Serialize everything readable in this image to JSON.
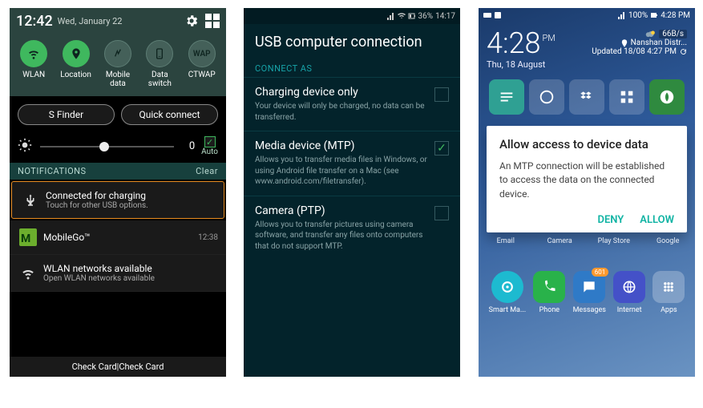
{
  "panel1": {
    "status": {
      "time": "12:42",
      "date": "Wed, January 22"
    },
    "tiles": [
      {
        "label": "WLAN",
        "on": true
      },
      {
        "label": "Location",
        "on": true
      },
      {
        "label": "Mobile data",
        "on": false
      },
      {
        "label": "Data switch",
        "on": false
      },
      {
        "label": "CTWAP",
        "on": false,
        "circle_text": "WAP"
      }
    ],
    "buttons": {
      "sfinder": "S Finder",
      "quickconnect": "Quick connect"
    },
    "brightness": {
      "value": "0",
      "auto_label": "Auto",
      "auto_checked": true
    },
    "notif_header": {
      "title": "NOTIFICATIONS",
      "clear": "Clear"
    },
    "notifs": [
      {
        "title": "Connected for charging",
        "sub": "Touch for other USB options.",
        "ts": ""
      },
      {
        "title": "MobileGo™",
        "sub": "",
        "ts": "12:38"
      },
      {
        "title": "WLAN networks available",
        "sub": "Open WLAN networks available",
        "ts": ""
      }
    ],
    "footer": "Check Card|Check Card"
  },
  "panel2": {
    "status": {
      "battery": "36%",
      "time": "14:17"
    },
    "title": "USB computer connection",
    "section": "CONNECT AS",
    "options": [
      {
        "title": "Charging device only",
        "desc": "Your device will only be charged, no data can be transferred.",
        "checked": false
      },
      {
        "title": "Media device (MTP)",
        "desc": "Allows you to transfer media files in Windows, or using Android file transfer on a Mac (see www.android.com/filetransfer).",
        "checked": true
      },
      {
        "title": "Camera (PTP)",
        "desc": "Allows you to transfer pictures using camera software, and transfer any files onto computers that do not support MTP.",
        "checked": false
      }
    ]
  },
  "panel3": {
    "status": {
      "battery": "100%",
      "time": "4:28 PM"
    },
    "clock": {
      "time": "4:28",
      "ampm": "PM",
      "date": "Thu, 18 August"
    },
    "weather": {
      "rate": "66B/s",
      "location": "Nanshan Distr...",
      "updated": "Updated 18/08 4:27 PM"
    },
    "dialog": {
      "title": "Allow access to device data",
      "body": "An MTP connection will be established to access the data on the connected device.",
      "deny": "DENY",
      "allow": "ALLOW"
    },
    "shelf_labels": [
      "Email",
      "Camera",
      "Play Store",
      "Google"
    ],
    "dock": [
      {
        "label": "Smart Ma..."
      },
      {
        "label": "Phone"
      },
      {
        "label": "Messages",
        "badge": "601"
      },
      {
        "label": "Internet"
      },
      {
        "label": "Apps"
      }
    ]
  }
}
